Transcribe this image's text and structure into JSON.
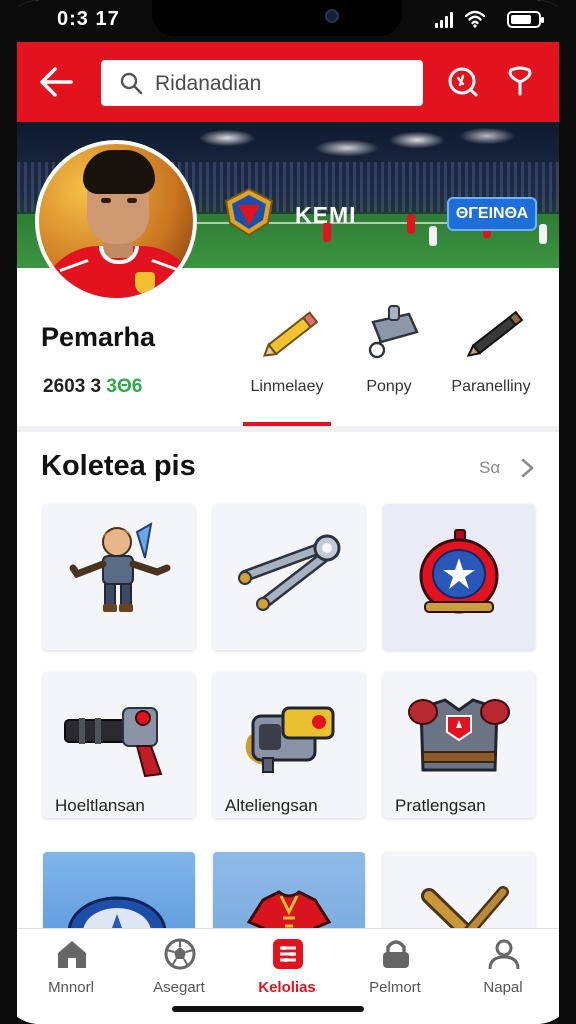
{
  "status_bar": {
    "time": "0:3 17"
  },
  "app_bar": {
    "search_query": "Ridanadian"
  },
  "banner": {
    "title": "KEMI",
    "button_label": "ΘΓΕΙΝΘΑ"
  },
  "profile": {
    "name": "Pemarha",
    "stat_primary": "2603 3",
    "stat_secondary": "3Θ6",
    "tools": [
      {
        "label": "Linmelaey",
        "icon": "pencil-icon"
      },
      {
        "label": "Ponpy",
        "icon": "clamp-icon"
      },
      {
        "label": "Paranelliny",
        "icon": "marker-icon"
      }
    ]
  },
  "collection": {
    "title": "Koletea pis",
    "see_all_label": "Sα",
    "items": [
      {
        "label": "",
        "icon": "warrior-figure-icon"
      },
      {
        "label": "",
        "icon": "wrench-icon"
      },
      {
        "label": "",
        "icon": "helmet-icon"
      },
      {
        "label": "Hoeltlansan",
        "icon": "blaster-icon"
      },
      {
        "label": "Alteliengsan",
        "icon": "gadget-icon"
      },
      {
        "label": "Pratlengsan",
        "icon": "armor-vest-icon"
      },
      {
        "label": "",
        "icon": "star-shield-icon"
      },
      {
        "label": "",
        "icon": "red-jersey-icon"
      },
      {
        "label": "",
        "icon": "crossed-bats-icon"
      }
    ]
  },
  "bottom_nav": [
    {
      "label": "Mnnorl",
      "icon": "home-icon",
      "active": false
    },
    {
      "label": "Asegart",
      "icon": "ball-icon",
      "active": false
    },
    {
      "label": "Kelolias",
      "icon": "collection-icon",
      "active": true
    },
    {
      "label": "Pelmort",
      "icon": "lock-icon",
      "active": false
    },
    {
      "label": "Napal",
      "icon": "profile-icon",
      "active": false
    }
  ],
  "colors": {
    "brand_red": "#e2131f",
    "accent_blue": "#1d6ed8",
    "stat_green": "#2ea84a"
  }
}
